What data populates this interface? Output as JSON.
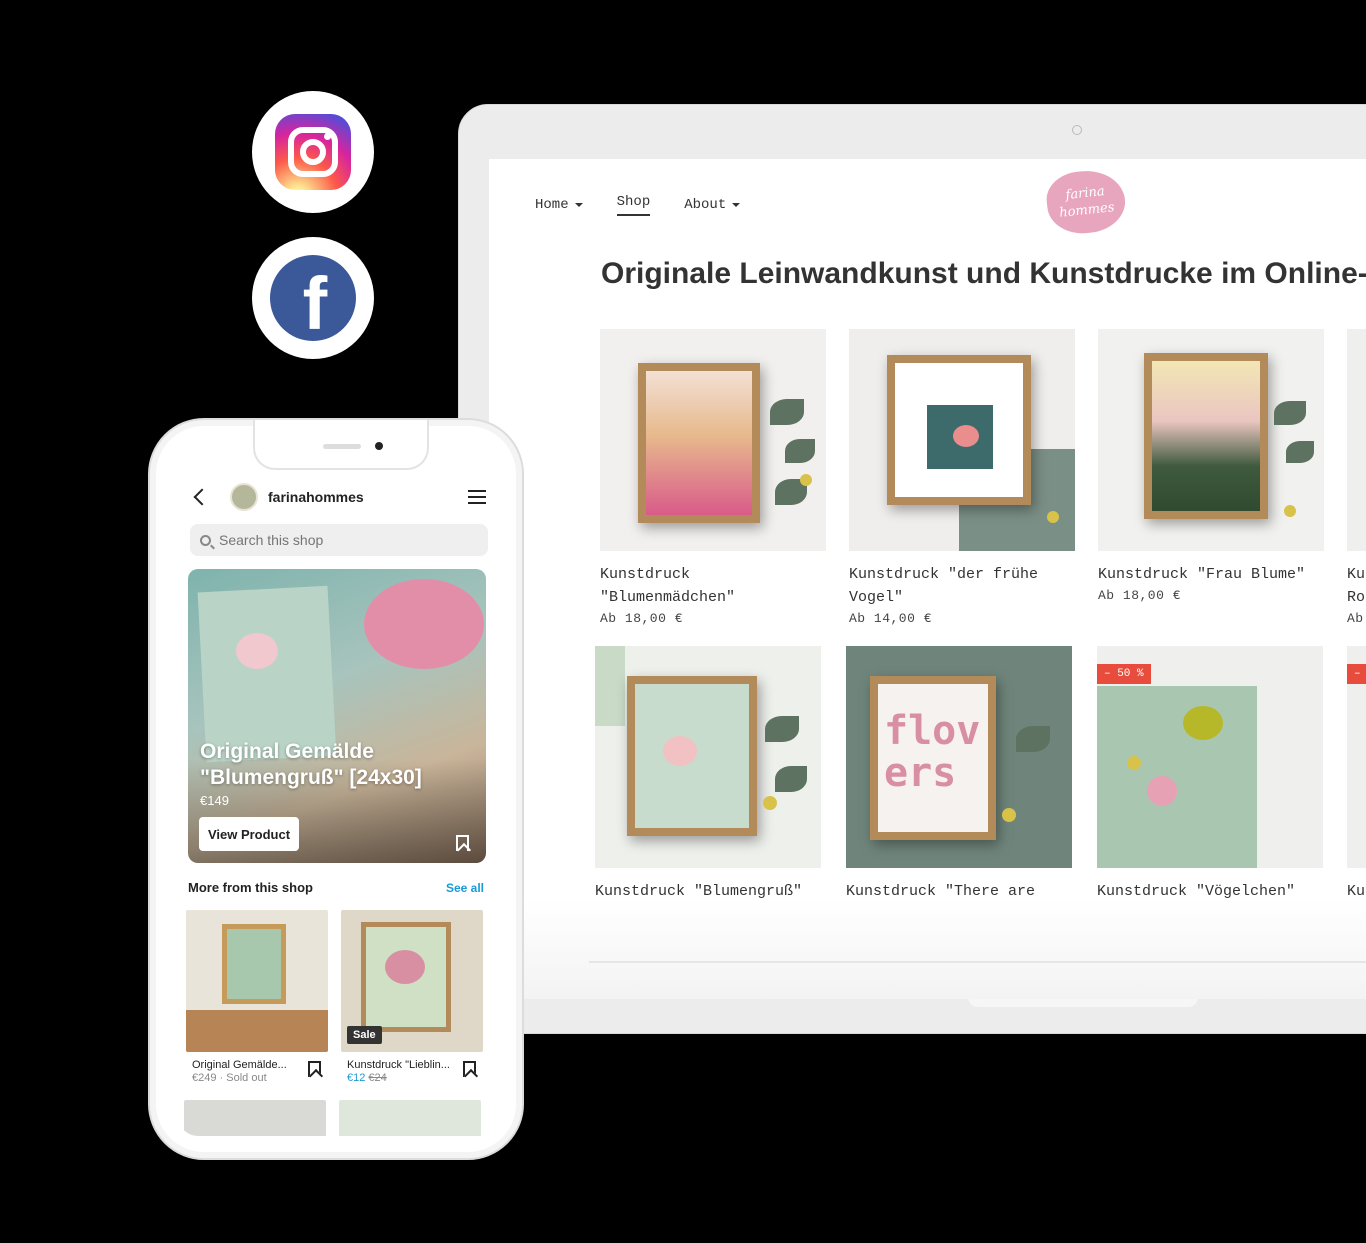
{
  "social": {
    "instagram_icon": "instagram-icon",
    "facebook_icon": "facebook-icon",
    "facebook_glyph": "f"
  },
  "laptop_site": {
    "brand": {
      "line1": "farina",
      "line2": "hommes"
    },
    "nav": [
      {
        "label": "Home",
        "has_dropdown": true
      },
      {
        "label": "Shop",
        "active": true
      },
      {
        "label": "About",
        "has_dropdown": true
      }
    ],
    "heading": "Originale Leinwandkunst und Kunstdrucke im Online-Shop",
    "products": [
      {
        "line1": "Kunstdruck",
        "line2": "\"Blumenmädchen\"",
        "price": "Ab 18,00 €"
      },
      {
        "line1": "Kunstdruck \"der frühe",
        "line2": "Vogel\"",
        "price": "Ab 14,00 €"
      },
      {
        "line1": "Kunstdruck \"Frau Blume\"",
        "line2": "",
        "price": "Ab 18,00 €"
      },
      {
        "line1": "Ku",
        "line2": "Ro",
        "price": "Ab"
      },
      {
        "line1": "Kunstdruck \"Blumengruß\"",
        "line2": "",
        "price": ""
      },
      {
        "line1": "Kunstdruck \"There are",
        "line2": "",
        "price": ""
      },
      {
        "line1": "Kunstdruck \"Vögelchen\"",
        "line2": "",
        "price": "",
        "badge": "– 50 %"
      },
      {
        "line1": "Ku",
        "line2": "",
        "price": "",
        "badge": "–"
      }
    ],
    "art_text": {
      "big1": "flov",
      "big2": "ers"
    }
  },
  "phone": {
    "username": "farinahommes",
    "search_placeholder": "Search this shop",
    "hero": {
      "title": "Original Gemälde \"Blumengruß\" [24x30]",
      "price": "€149",
      "button": "View Product"
    },
    "more_title": "More from this shop",
    "see_all": "See all",
    "tiles": [
      {
        "name": "Original Gemälde...",
        "price": "€249",
        "status": "· Sold out"
      },
      {
        "name": "Kunstdruck \"Lieblin...",
        "price": "€12",
        "old_price": "€24",
        "tag": "Sale"
      }
    ]
  },
  "colors": {
    "brand_pink": "#e8a5be",
    "facebook_blue": "#3b5998",
    "link_blue": "#1a9bd7",
    "sale_red": "#e74c3c"
  }
}
